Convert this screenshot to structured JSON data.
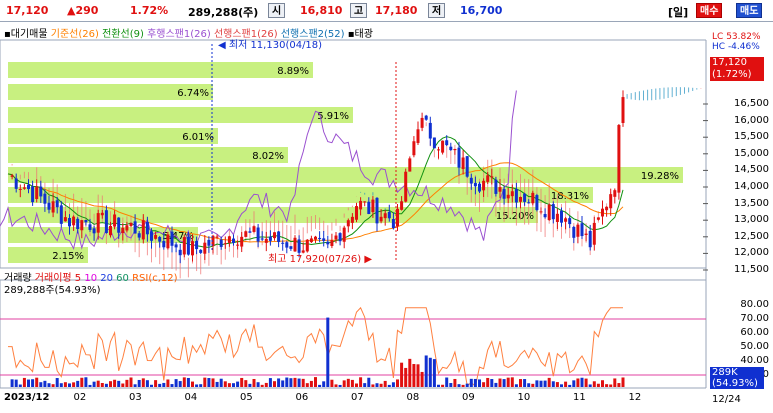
{
  "topbar": {
    "price": "17,120",
    "change": "▲290",
    "change_pct": "1.72%",
    "volume": "289,288(주)",
    "open_label": "시",
    "open": "16,810",
    "high_label": "고",
    "high": "17,180",
    "low_label": "저",
    "low": "16,700",
    "period": "[일]",
    "buy": "매수",
    "sell": "매도"
  },
  "price_legend": {
    "items": [
      "대기매물",
      "기준선(26)",
      "전환선(9)",
      "후행스팬1(26)",
      "선행스팬1(26)",
      "선행스팬2(52)",
      "태광"
    ]
  },
  "price_panel": {
    "lc_label": "LC",
    "lc_value": "53.82%",
    "hc_label": "HC",
    "hc_value": "-4.46%",
    "current_price": "17,120",
    "current_pct": "(1.72%)",
    "y_ticks": [
      "16,500",
      "16,000",
      "15,500",
      "15,000",
      "14,500",
      "14,000",
      "13,500",
      "13,000",
      "12,500",
      "12,000",
      "11,500"
    ],
    "volume_profile_pcts": [
      "8.89%",
      "6.74%",
      "5.91%",
      "6.01%",
      "8.02%",
      "19.28%",
      "18.31%",
      "15.20%",
      "5.47%",
      "2.15%"
    ],
    "low_annotation": "최저 11,130(04/18)",
    "high_annotation": "최고 17,920(07/26)"
  },
  "lower_legend": {
    "items": [
      "거래량",
      "거래이평 5",
      "10",
      "20",
      "60",
      "RSI(c,12)"
    ],
    "volume_text": "289,288주(54.93%)"
  },
  "lower_panel": {
    "y_ticks": [
      "80.00",
      "70.00",
      "60.00",
      "50.00",
      "40.00",
      "30.00"
    ],
    "vol_badge_1": "289K",
    "vol_badge_2": "(54.93%)"
  },
  "x_axis": {
    "labels": [
      "2023/12",
      "02",
      "03",
      "04",
      "05",
      "06",
      "07",
      "08",
      "09",
      "10",
      "11",
      "12"
    ],
    "right_label": "12/24"
  },
  "colors": {
    "up": "#e01010",
    "down": "#1030d0",
    "cloud_green": "#c8f080",
    "cloud_blue": "#2090c0",
    "cloud_red": "#f07070",
    "rsi_line": "#ff8040",
    "rsi_band": "#e040a0"
  }
}
